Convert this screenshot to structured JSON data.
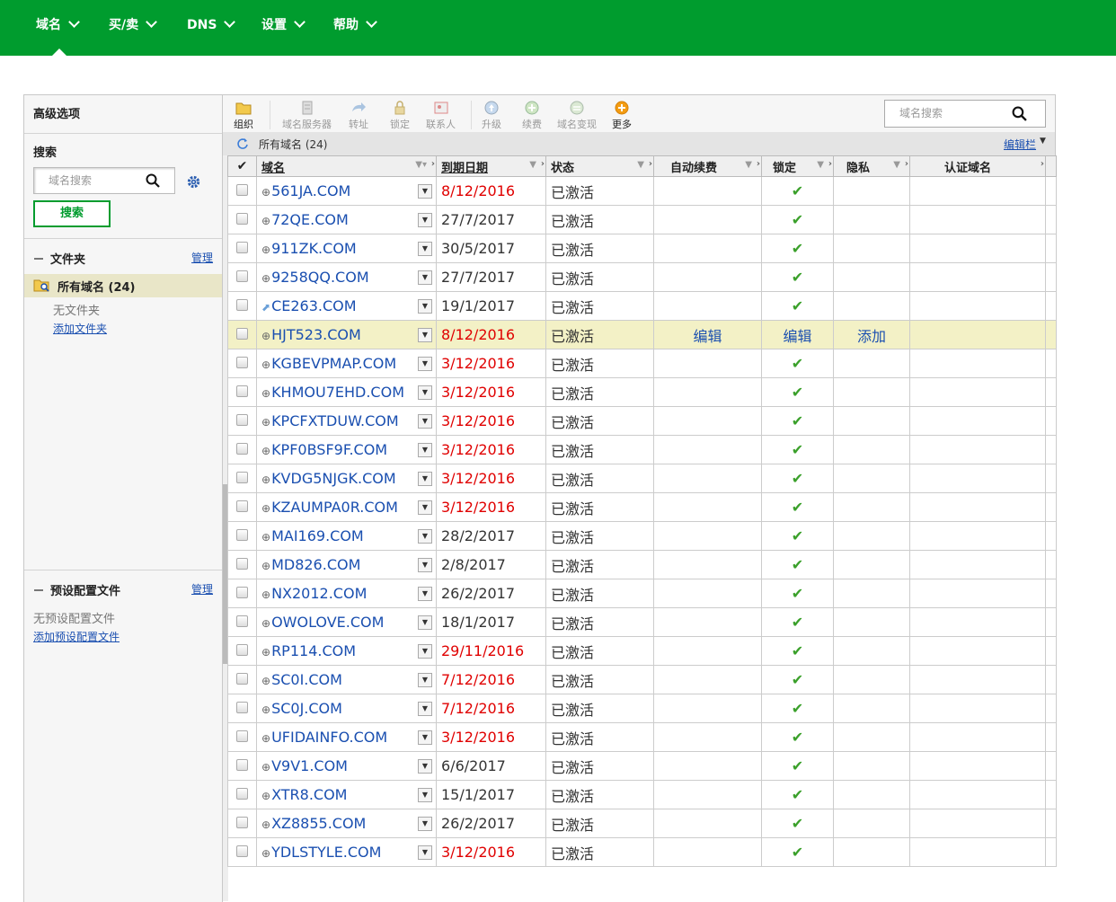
{
  "nav": {
    "items": [
      {
        "label": "域名"
      },
      {
        "label": "买/卖"
      },
      {
        "label": "DNS"
      },
      {
        "label": "设置"
      },
      {
        "label": "帮助"
      }
    ]
  },
  "sidebar": {
    "title": "高级选项",
    "search_label": "搜索",
    "search_placeholder": "域名搜索",
    "search_button": "搜索",
    "folders_title": "文件夹",
    "folders_manage": "管理",
    "folder_selected": "所有域名 (24)",
    "no_folder": "无文件夹",
    "add_folder": "添加文件夹",
    "presets_title": "预设配置文件",
    "presets_manage": "管理",
    "no_presets": "无预设配置文件",
    "add_preset": "添加预设配置文件"
  },
  "toolbar": {
    "organize": "组织",
    "nameservers": "域名服务器",
    "forward": "转址",
    "lock": "锁定",
    "contacts": "联系人",
    "upgrade": "升级",
    "renew": "续费",
    "domain_change": "域名变现",
    "more": "更多",
    "search_placeholder": "域名搜索"
  },
  "subbar": {
    "all_domains": "所有域名 (24)",
    "edit_columns": "编辑栏"
  },
  "table": {
    "headers": {
      "domain": "域名",
      "expiry": "到期日期",
      "status": "状态",
      "auto_renew": "自动续费",
      "lock": "锁定",
      "privacy": "隐私",
      "cert": "认证域名"
    },
    "rows": [
      {
        "domain": "561JA.COM",
        "date": "8/12/2016",
        "status": "已激活"
      },
      {
        "domain": "72QE.COM",
        "date": "27/7/2017",
        "status": "已激活"
      },
      {
        "domain": "911ZK.COM",
        "date": "30/5/2017",
        "status": "已激活"
      },
      {
        "domain": "9258QQ.COM",
        "date": "27/7/2017",
        "status": "已激活"
      },
      {
        "domain": "CE263.COM",
        "date": "19/1/2017",
        "status": "已激活"
      },
      {
        "domain": "HJT523.COM",
        "date": "8/12/2016",
        "status": "已激活",
        "auto": "编辑",
        "lock": "编辑",
        "privacy": "添加"
      },
      {
        "domain": "KGBEVPMAP.COM",
        "date": "3/12/2016",
        "status": "已激活"
      },
      {
        "domain": "KHMOU7EHD.COM",
        "date": "3/12/2016",
        "status": "已激活"
      },
      {
        "domain": "KPCFXTDUW.COM",
        "date": "3/12/2016",
        "status": "已激活"
      },
      {
        "domain": "KPF0BSF9F.COM",
        "date": "3/12/2016",
        "status": "已激活"
      },
      {
        "domain": "KVDG5NJGK.COM",
        "date": "3/12/2016",
        "status": "已激活"
      },
      {
        "domain": "KZAUMPA0R.COM",
        "date": "3/12/2016",
        "status": "已激活"
      },
      {
        "domain": "MAI169.COM",
        "date": "28/2/2017",
        "status": "已激活"
      },
      {
        "domain": "MD826.COM",
        "date": "2/8/2017",
        "status": "已激活"
      },
      {
        "domain": "NX2012.COM",
        "date": "26/2/2017",
        "status": "已激活"
      },
      {
        "domain": "OWOLOVE.COM",
        "date": "18/1/2017",
        "status": "已激活"
      },
      {
        "domain": "RP114.COM",
        "date": "29/11/2016",
        "status": "已激活"
      },
      {
        "domain": "SC0I.COM",
        "date": "7/12/2016",
        "status": "已激活"
      },
      {
        "domain": "SC0J.COM",
        "date": "7/12/2016",
        "status": "已激活"
      },
      {
        "domain": "UFIDAINFO.COM",
        "date": "3/12/2016",
        "status": "已激活"
      },
      {
        "domain": "V9V1.COM",
        "date": "6/6/2017",
        "status": "已激活"
      },
      {
        "domain": "XTR8.COM",
        "date": "15/1/2017",
        "status": "已激活"
      },
      {
        "domain": "XZ8855.COM",
        "date": "26/2/2017",
        "status": "已激活"
      },
      {
        "domain": "YDLSTYLE.COM",
        "date": "3/12/2016",
        "status": "已激活"
      }
    ]
  },
  "colors": {
    "brand": "#009c2e",
    "link": "#1a4fb0",
    "expiring": "#e00000",
    "highlight_row": "#f3f1c6",
    "tick": "#3aa02a"
  }
}
